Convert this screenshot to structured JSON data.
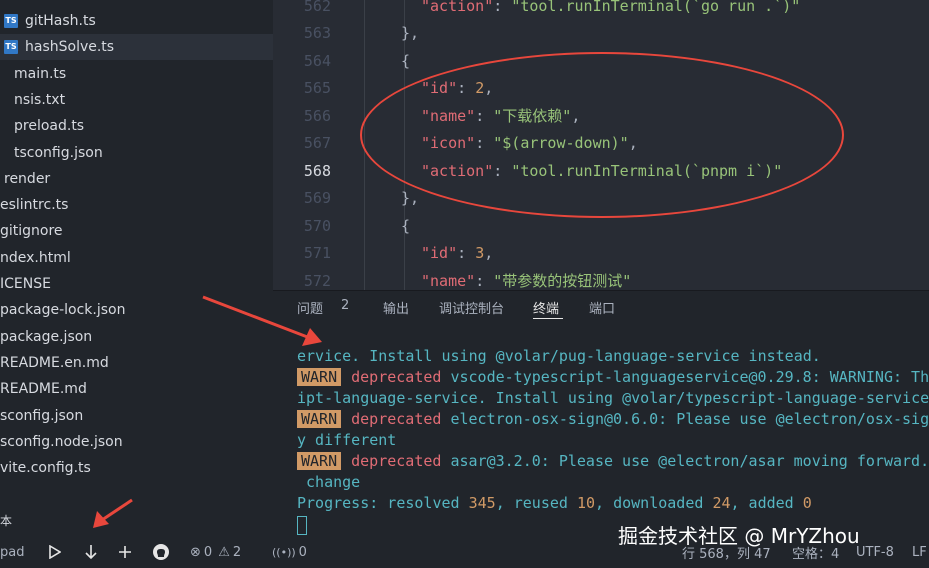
{
  "sidebar": {
    "files": [
      {
        "label": "gitHash.ts",
        "icon": "ts-file-icon",
        "icon_text": "TS"
      },
      {
        "label": "hashSolve.ts",
        "icon": "ts-file-icon",
        "icon_text": "TS",
        "selected": true
      },
      {
        "label": "main.ts"
      },
      {
        "label": "nsis.txt"
      },
      {
        "label": "preload.ts"
      },
      {
        "label": "tsconfig.json"
      },
      {
        "label": "render"
      },
      {
        "label": "eslintrc.ts"
      },
      {
        "label": "gitignore"
      },
      {
        "label": "ndex.html"
      },
      {
        "label": "ICENSE"
      },
      {
        "label": "package-lock.json"
      },
      {
        "label": "package.json"
      },
      {
        "label": "README.en.md"
      },
      {
        "label": "README.md"
      },
      {
        "label": "sconfig.json"
      },
      {
        "label": "sconfig.node.json"
      },
      {
        "label": "vite.config.ts"
      }
    ],
    "section_label": "本"
  },
  "editor": {
    "lines": [
      {
        "num": "562",
        "tokens": [
          {
            "t": "\"action\"",
            "c": "k"
          },
          {
            "t": ": ",
            "c": "p"
          },
          {
            "t": "\"tool.runInTerminal(`go run .`)\"",
            "c": "s"
          }
        ],
        "indent": 3
      },
      {
        "num": "563",
        "tokens": [
          {
            "t": "},",
            "c": "p"
          }
        ],
        "indent": 2
      },
      {
        "num": "564",
        "tokens": [
          {
            "t": "{",
            "c": "p"
          }
        ],
        "indent": 2
      },
      {
        "num": "565",
        "tokens": [
          {
            "t": "\"id\"",
            "c": "k"
          },
          {
            "t": ": ",
            "c": "p"
          },
          {
            "t": "2",
            "c": "n"
          },
          {
            "t": ",",
            "c": "p"
          }
        ],
        "indent": 3
      },
      {
        "num": "566",
        "tokens": [
          {
            "t": "\"name\"",
            "c": "k"
          },
          {
            "t": ": ",
            "c": "p"
          },
          {
            "t": "\"下载依赖\"",
            "c": "s"
          },
          {
            "t": ",",
            "c": "p"
          }
        ],
        "indent": 3
      },
      {
        "num": "567",
        "tokens": [
          {
            "t": "\"icon\"",
            "c": "k"
          },
          {
            "t": ": ",
            "c": "p"
          },
          {
            "t": "\"$(arrow-down)\"",
            "c": "s"
          },
          {
            "t": ",",
            "c": "p"
          }
        ],
        "indent": 3
      },
      {
        "num": "568",
        "active": true,
        "tokens": [
          {
            "t": "\"action\"",
            "c": "k"
          },
          {
            "t": ": ",
            "c": "p"
          },
          {
            "t": "\"tool.runInTerminal(`pnpm i`)\"",
            "c": "s"
          }
        ],
        "indent": 3
      },
      {
        "num": "569",
        "tokens": [
          {
            "t": "},",
            "c": "p"
          }
        ],
        "indent": 2
      },
      {
        "num": "570",
        "tokens": [
          {
            "t": "{",
            "c": "p"
          }
        ],
        "indent": 2
      },
      {
        "num": "571",
        "tokens": [
          {
            "t": "\"id\"",
            "c": "k"
          },
          {
            "t": ": ",
            "c": "p"
          },
          {
            "t": "3",
            "c": "n"
          },
          {
            "t": ",",
            "c": "p"
          }
        ],
        "indent": 3
      },
      {
        "num": "572",
        "tokens": [
          {
            "t": "\"name\"",
            "c": "k"
          },
          {
            "t": ": ",
            "c": "p"
          },
          {
            "t": "\"带参数的按钮测试\"",
            "c": "s"
          }
        ],
        "indent": 3
      }
    ]
  },
  "panel": {
    "tabs": [
      {
        "label": "问题",
        "badge": "2"
      },
      {
        "label": "输出"
      },
      {
        "label": "调试控制台"
      },
      {
        "label": "终端",
        "active": true
      },
      {
        "label": "端口"
      }
    ]
  },
  "terminal": {
    "lines": [
      [
        {
          "t": "ervice. Install using @volar/pug-language-service instead.",
          "c": "c-cyan"
        }
      ],
      [
        {
          "t": "WARN",
          "c": "warn"
        },
        {
          "t": "deprecated ",
          "c": "c-red"
        },
        {
          "t": "vscode-typescript-languageservice@0.29.8: WARNING: Th",
          "c": "c-cyan"
        }
      ],
      [
        {
          "t": "ipt-language-service. Install using @volar/typescript-language-service",
          "c": "c-cyan"
        }
      ],
      [
        {
          "t": "WARN",
          "c": "warn"
        },
        {
          "t": "deprecated ",
          "c": "c-red"
        },
        {
          "t": "electron-osx-sign@0.6.0: Please use @electron/osx-sig",
          "c": "c-cyan"
        }
      ],
      [
        {
          "t": "y different",
          "c": "c-cyan"
        }
      ],
      [
        {
          "t": "WARN",
          "c": "warn"
        },
        {
          "t": "deprecated ",
          "c": "c-red"
        },
        {
          "t": "asar@3.2.0: Please use @electron/asar moving forward.",
          "c": "c-cyan"
        }
      ],
      [
        {
          "t": " change",
          "c": "c-cyan"
        }
      ],
      [
        {
          "t": "Progress: resolved ",
          "c": "c-cyan"
        },
        {
          "t": "345",
          "c": "c-num"
        },
        {
          "t": ", reused ",
          "c": "c-cyan"
        },
        {
          "t": "10",
          "c": "c-num"
        },
        {
          "t": ", downloaded ",
          "c": "c-cyan"
        },
        {
          "t": "24",
          "c": "c-num"
        },
        {
          "t": ", added ",
          "c": "c-cyan"
        },
        {
          "t": "0",
          "c": "c-num"
        }
      ]
    ]
  },
  "statusbar": {
    "left_label": "pad",
    "errors": "0",
    "warnings": "2",
    "ports": "0",
    "position": "行 568，列 47",
    "spaces": "空格：4",
    "encoding": "UTF-8",
    "eol": "LF"
  },
  "watermark": "掘金技术社区 @ MrYZhou",
  "colors": {
    "annotation": "#e8473c",
    "accent_cyan": "#56b6c2",
    "warn_bg": "#d19a66"
  }
}
